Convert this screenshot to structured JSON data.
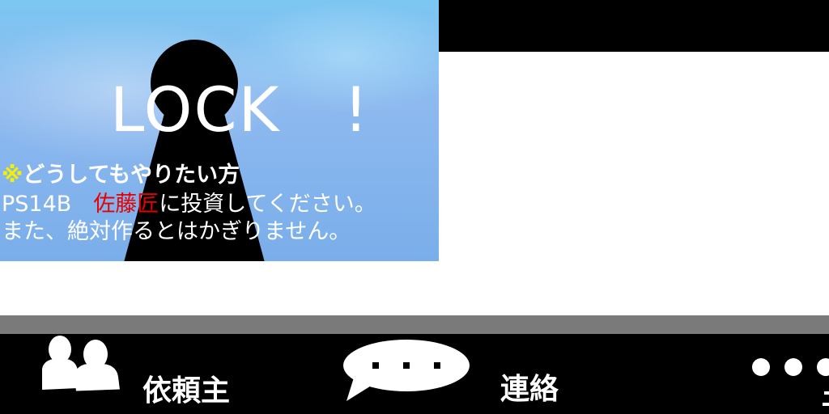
{
  "lock_panel": {
    "title": "LOCK　!",
    "line1_mark": "※",
    "line1_text": "どうしてもやりたい方",
    "line2_pre": "PS14B　",
    "line2_name": "佐藤匠",
    "line2_post": "に投資してください。",
    "line3": "また、絶対作るとはかぎりません。"
  },
  "nav": {
    "client_label": "依頼主",
    "contact_label": "連絡"
  },
  "icons": {
    "client": "users-icon",
    "contact": "speech-bubble-icon",
    "more": "more-dots-icon"
  },
  "colors": {
    "panel_sky": "#8db9ef",
    "highlight_mark": "#f4f000",
    "highlight_name": "#e60000",
    "bar": "#000000",
    "divider": "#7a7a7a"
  }
}
